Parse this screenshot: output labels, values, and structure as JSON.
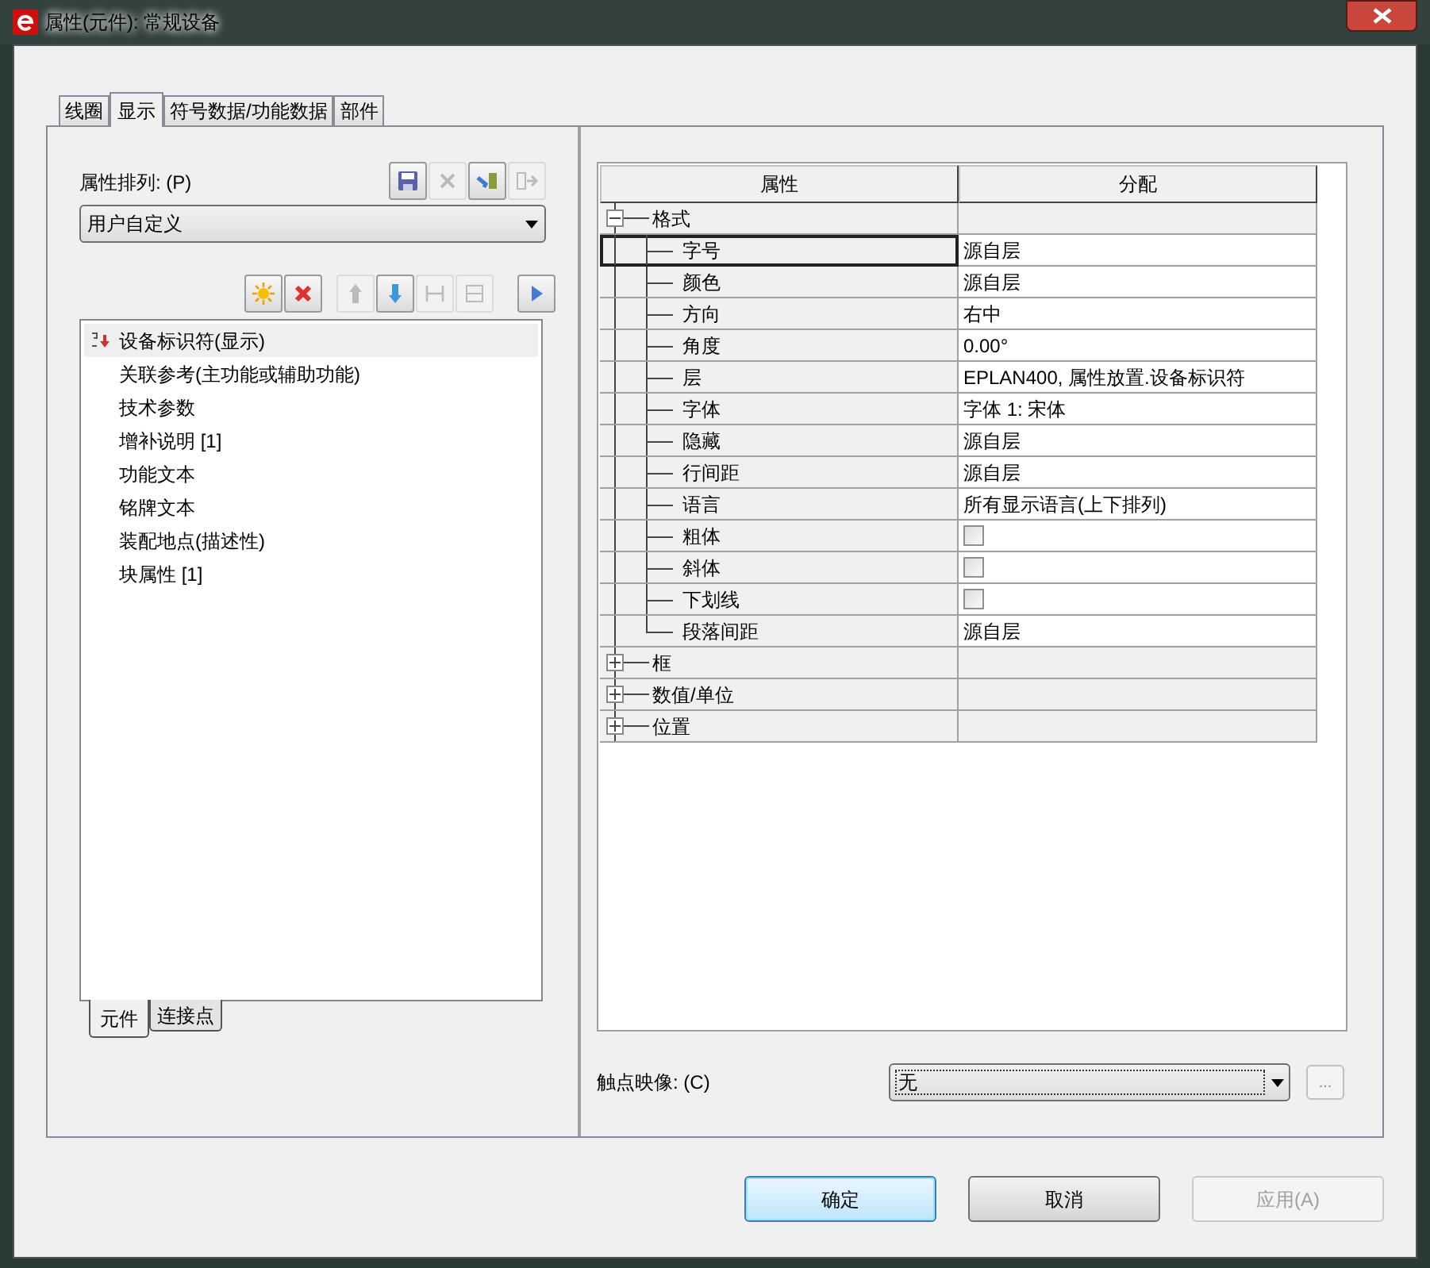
{
  "window": {
    "title": "属性(元件): 常规设备"
  },
  "tabs": [
    {
      "label": "线圈",
      "selected": false
    },
    {
      "label": "显示",
      "selected": true
    },
    {
      "label": "符号数据/功能数据",
      "selected": false
    },
    {
      "label": "部件",
      "selected": false
    }
  ],
  "sort": {
    "label": "属性排列: (P)",
    "value": "用户自定义"
  },
  "sort_toolbar": [
    {
      "kind": "save",
      "disabled": false
    },
    {
      "kind": "remove",
      "disabled": true
    },
    {
      "kind": "import",
      "disabled": false
    },
    {
      "kind": "export",
      "disabled": true
    }
  ],
  "list_toolbar": [
    {
      "kind": "new",
      "disabled": false
    },
    {
      "kind": "delete",
      "disabled": false
    },
    {
      "kind": "up",
      "disabled": true
    },
    {
      "kind": "down",
      "disabled": false
    },
    {
      "kind": "split",
      "disabled": true
    },
    {
      "kind": "merge",
      "disabled": true
    },
    {
      "kind": "more",
      "disabled": false
    }
  ],
  "attribute_list": [
    {
      "label": "设备标识符(显示)",
      "selected": true
    },
    {
      "label": "关联参考(主功能或辅助功能)",
      "selected": false
    },
    {
      "label": "技术参数",
      "selected": false
    },
    {
      "label": "增补说明 [1]",
      "selected": false
    },
    {
      "label": "功能文本",
      "selected": false
    },
    {
      "label": "铭牌文本",
      "selected": false
    },
    {
      "label": "装配地点(描述性)",
      "selected": false
    },
    {
      "label": "块属性 [1]",
      "selected": false
    }
  ],
  "bottom_tabs": [
    {
      "label": "元件",
      "selected": true
    },
    {
      "label": "连接点",
      "selected": false
    }
  ],
  "table": {
    "columns": [
      "属性",
      "分配"
    ],
    "rows": [
      {
        "label": "格式",
        "expanded": true,
        "children": [
          {
            "label": "字号",
            "kind": "text",
            "value": "源自层",
            "selected": true
          },
          {
            "label": "颜色",
            "kind": "text",
            "value": "源自层",
            "selected": false
          },
          {
            "label": "方向",
            "kind": "text",
            "value": "右中",
            "selected": false
          },
          {
            "label": "角度",
            "kind": "text",
            "value": "0.00°",
            "selected": false
          },
          {
            "label": "层",
            "kind": "text",
            "value": "EPLAN400, 属性放置.设备标识符",
            "selected": false
          },
          {
            "label": "字体",
            "kind": "text",
            "value": "字体 1: 宋体",
            "selected": false
          },
          {
            "label": "隐藏",
            "kind": "text",
            "value": "源自层",
            "selected": false
          },
          {
            "label": "行间距",
            "kind": "text",
            "value": "源自层",
            "selected": false
          },
          {
            "label": "语言",
            "kind": "text",
            "value": "所有显示语言(上下排列)",
            "selected": false
          },
          {
            "label": "粗体",
            "kind": "checkbox",
            "checked": false,
            "selected": false
          },
          {
            "label": "斜体",
            "kind": "checkbox",
            "checked": false,
            "selected": false
          },
          {
            "label": "下划线",
            "kind": "checkbox",
            "checked": false,
            "selected": false
          },
          {
            "label": "段落间距",
            "kind": "text",
            "value": "源自层",
            "selected": false
          }
        ]
      },
      {
        "label": "框",
        "expanded": false
      },
      {
        "label": "数值/单位",
        "expanded": false
      },
      {
        "label": "位置",
        "expanded": false
      }
    ]
  },
  "contact_mapping": {
    "label": "触点映像: (C)",
    "value": "无",
    "button": "..."
  },
  "buttons": [
    {
      "label": "确定",
      "kind": "default",
      "disabled": false
    },
    {
      "label": "取消",
      "kind": "normal",
      "disabled": false
    },
    {
      "label": "应用(A)",
      "kind": "normal",
      "disabled": true
    }
  ]
}
